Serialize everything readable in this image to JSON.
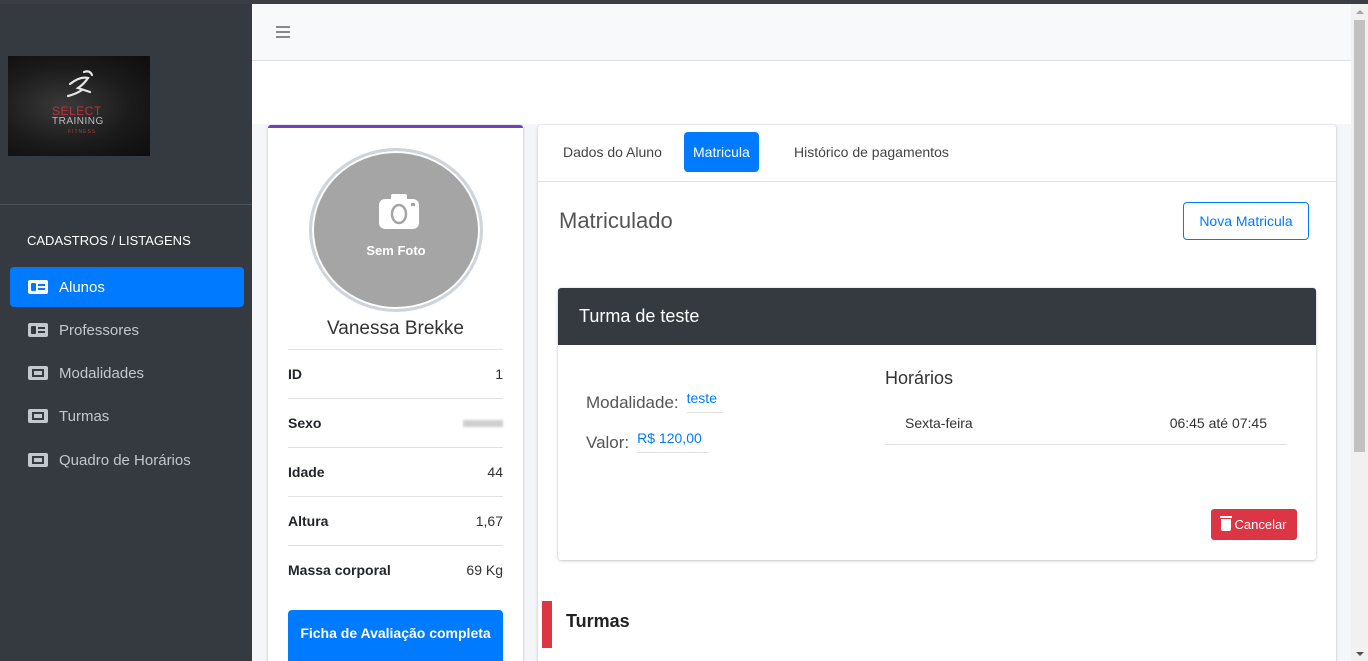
{
  "sidebar": {
    "logo": {
      "word1": "SELECT",
      "word2": "TRAINING",
      "word3": "FITNESS"
    },
    "section_header": "CADASTROS / LISTAGENS",
    "items": [
      {
        "label": "Alunos",
        "icon": "id-card-icon",
        "active": true
      },
      {
        "label": "Professores",
        "icon": "id-card-icon",
        "active": false
      },
      {
        "label": "Modalidades",
        "icon": "ticket-icon",
        "active": false
      },
      {
        "label": "Turmas",
        "icon": "ticket-icon",
        "active": false
      },
      {
        "label": "Quadro de Horários",
        "icon": "ticket-icon",
        "active": false
      }
    ]
  },
  "topbar": {
    "menu_icon": "hamburger-icon"
  },
  "profile": {
    "photo_placeholder": "Sem Foto",
    "name": "Vanessa Brekke",
    "rows": [
      {
        "label": "ID",
        "value": "1"
      },
      {
        "label": "Sexo",
        "value": ""
      },
      {
        "label": "Idade",
        "value": "44"
      },
      {
        "label": "Altura",
        "value": "1,67"
      },
      {
        "label": "Massa corporal",
        "value": "69 Kg"
      }
    ],
    "ficha_button": "Ficha de Avaliação completa"
  },
  "tabs": [
    {
      "label": "Dados do Aluno",
      "active": false
    },
    {
      "label": "Matricula",
      "active": true
    },
    {
      "label": "Histórico de pagamentos",
      "active": false
    }
  ],
  "matricula": {
    "status": "Matriculado",
    "new_button": "Nova Matricula",
    "turma": {
      "title": "Turma de teste",
      "modalidade_label": "Modalidade:",
      "modalidade_value": "teste",
      "valor_label": "Valor:",
      "valor_value": "R$ 120,00",
      "horarios_title": "Horários",
      "horarios": [
        {
          "day": "Sexta-feira",
          "time": "06:45 até 07:45"
        }
      ],
      "cancel_button": "Cancelar"
    },
    "turmas_section_title": "Turmas"
  },
  "colors": {
    "primary": "#007bff",
    "danger": "#dc3545",
    "sidebar": "#343a40",
    "card_accent": "#6f42c1"
  }
}
